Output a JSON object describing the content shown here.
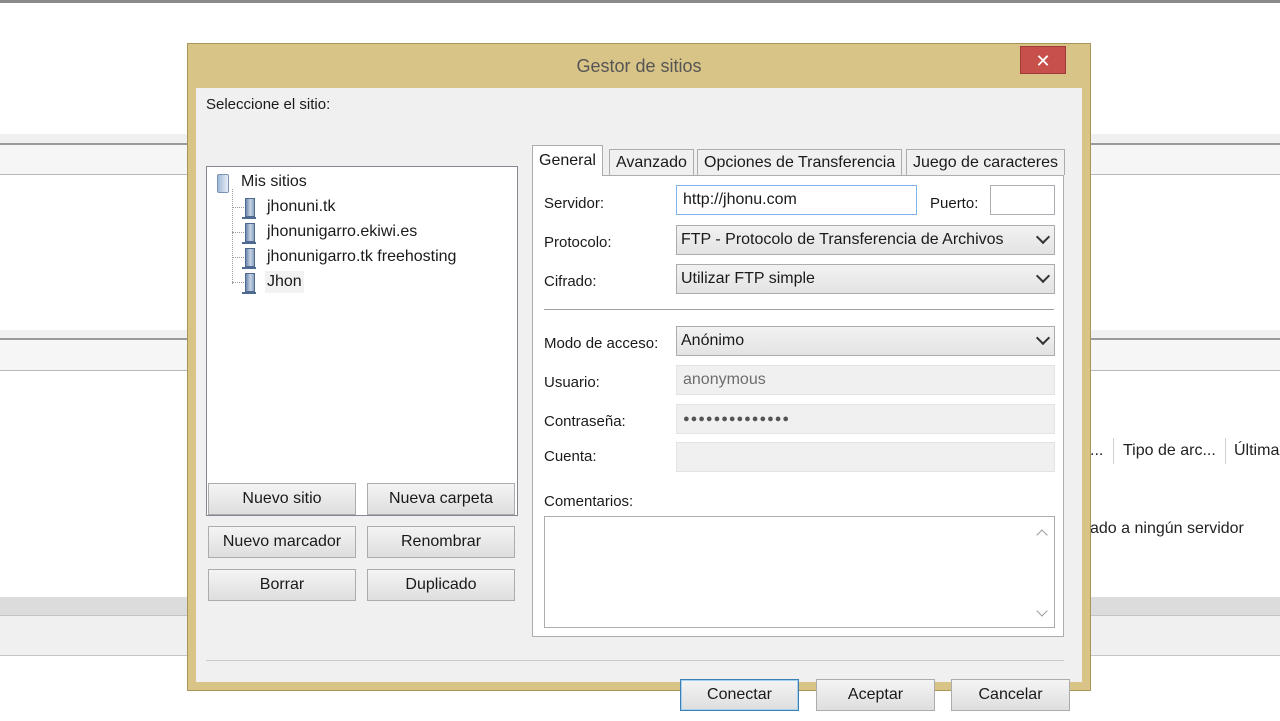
{
  "background": {
    "columns": [
      "...",
      "Tipo de arc...",
      "Última"
    ],
    "status_text": "ado a ningún servidor"
  },
  "dialog": {
    "title": "Gestor de sitios",
    "close_label": "✕",
    "select_site_label": "Seleccione el sitio:",
    "tree": {
      "root": "Mis sitios",
      "sites": [
        "jhonuni.tk",
        "jhonunigarro.ekiwi.es",
        "jhonunigarro.tk freehosting",
        "Jhon"
      ],
      "selected": "Jhon"
    },
    "left_buttons": {
      "new_site": "Nuevo sitio",
      "new_folder": "Nueva carpeta",
      "new_bookmark": "Nuevo marcador",
      "rename": "Renombrar",
      "delete": "Borrar",
      "duplicate": "Duplicado"
    },
    "tabs": [
      "General",
      "Avanzado",
      "Opciones de Transferencia",
      "Juego de caracteres"
    ],
    "active_tab": "General",
    "form": {
      "server_label": "Servidor:",
      "server_value": "http://jhonu.com",
      "port_label": "Puerto:",
      "port_value": "",
      "protocol_label": "Protocolo:",
      "protocol_value": "FTP - Protocolo de Transferencia de Archivos",
      "encryption_label": "Cifrado:",
      "encryption_value": "Utilizar FTP simple",
      "logon_label": "Modo de acceso:",
      "logon_value": "Anónimo",
      "user_label": "Usuario:",
      "user_value": "anonymous",
      "password_label": "Contraseña:",
      "password_value": "●●●●●●●●●●●●●●",
      "account_label": "Cuenta:",
      "account_value": "",
      "comments_label": "Comentarios:",
      "comments_value": ""
    },
    "footer_buttons": {
      "connect": "Conectar",
      "ok": "Aceptar",
      "cancel": "Cancelar"
    }
  },
  "colors": {
    "dialog_frame": "#d9c488",
    "close_button": "#c7504a",
    "client_bg": "#f0f0f0"
  }
}
